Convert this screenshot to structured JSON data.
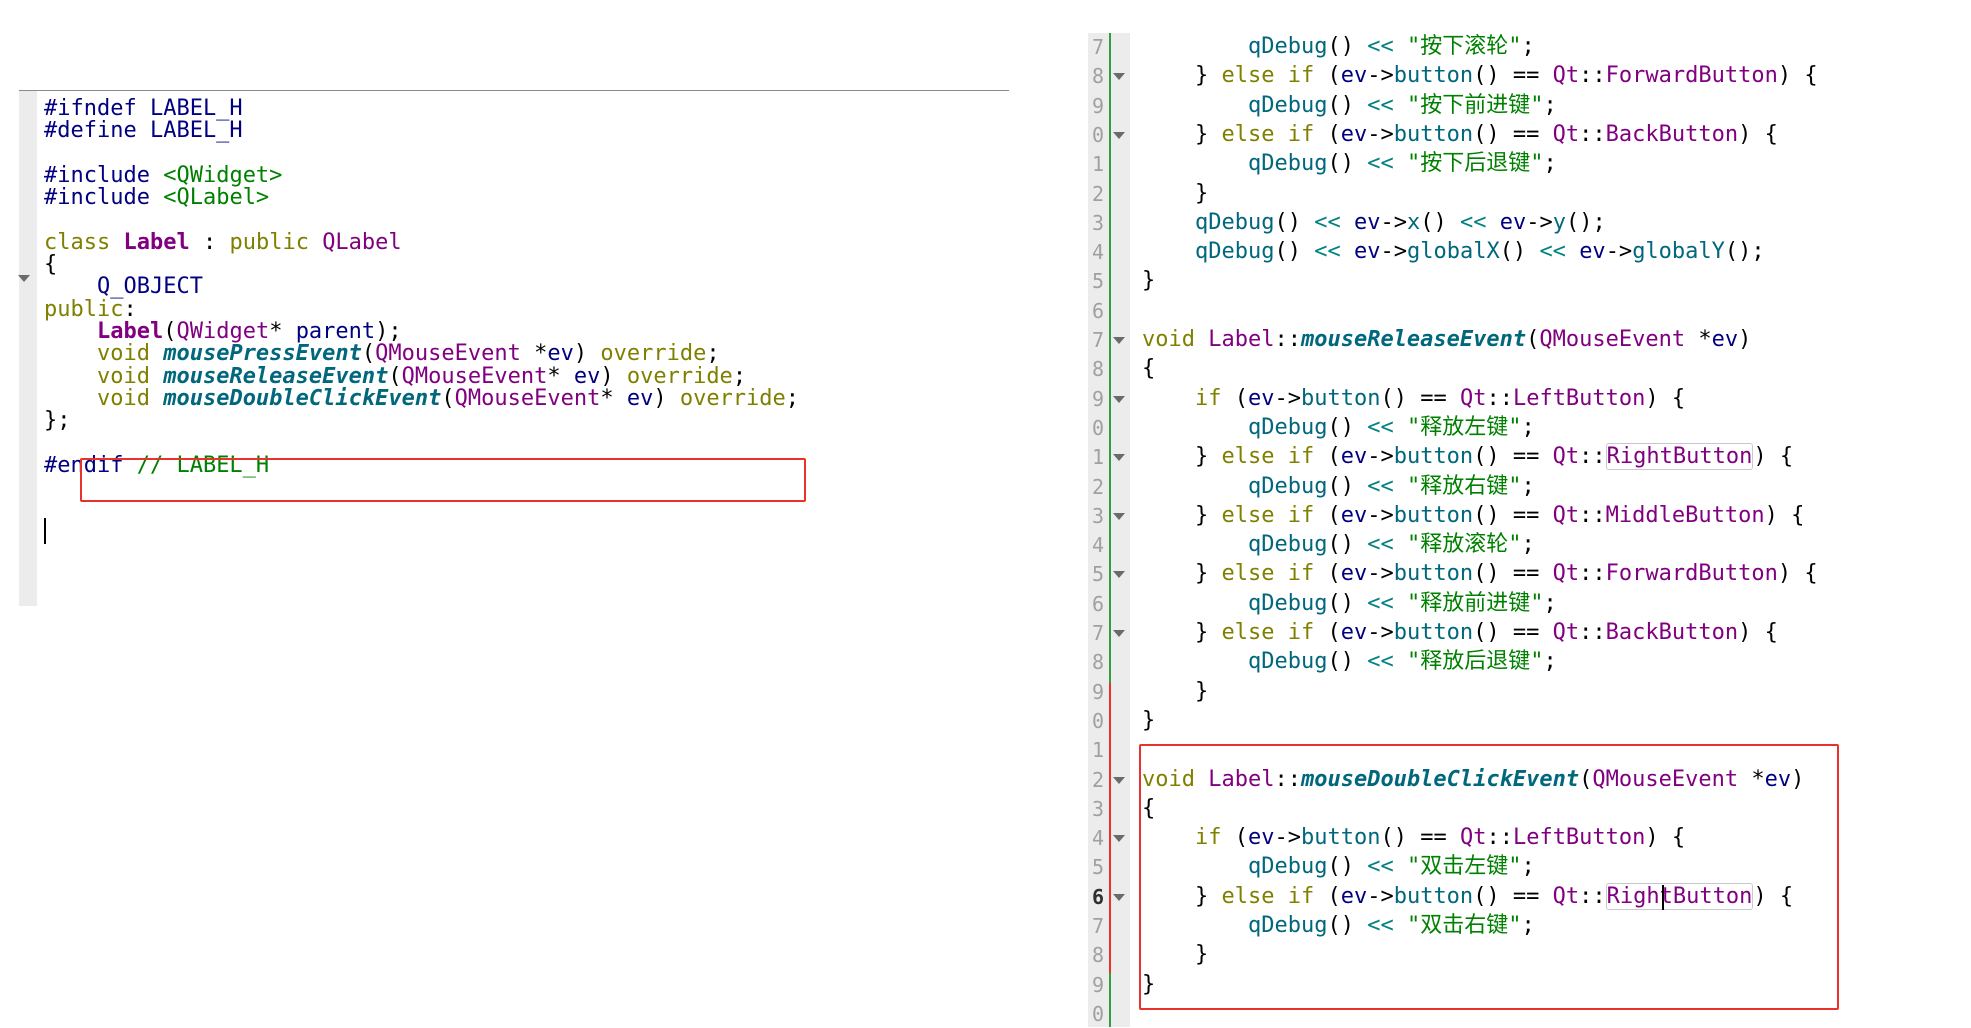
{
  "left_editor": {
    "lines": [
      [
        {
          "t": "#ifndef LABEL_H",
          "c": "pp"
        }
      ],
      [
        {
          "t": "#define LABEL_H",
          "c": "pp"
        }
      ],
      [],
      [
        {
          "t": "#include ",
          "c": "pp"
        },
        {
          "t": "<QWidget>",
          "c": "inc"
        }
      ],
      [
        {
          "t": "#include ",
          "c": "pp"
        },
        {
          "t": "<QLabel>",
          "c": "inc"
        }
      ],
      [],
      [
        {
          "t": "class ",
          "c": "kw"
        },
        {
          "t": "Label",
          "c": "cls"
        },
        {
          "t": " : ",
          "c": "plain"
        },
        {
          "t": "public ",
          "c": "kw"
        },
        {
          "t": "QLabel",
          "c": "ty"
        }
      ],
      [
        {
          "t": "{",
          "c": "plain"
        }
      ],
      [
        {
          "t": "    Q_OBJECT",
          "c": "macro"
        }
      ],
      [
        {
          "t": "public",
          "c": "kw"
        },
        {
          "t": ":",
          "c": "plain"
        }
      ],
      [
        {
          "t": "    ",
          "c": "plain"
        },
        {
          "t": "Label",
          "c": "cls"
        },
        {
          "t": "(",
          "c": "plain"
        },
        {
          "t": "QWidget",
          "c": "ty"
        },
        {
          "t": "* ",
          "c": "plain"
        },
        {
          "t": "parent",
          "c": "var"
        },
        {
          "t": ");",
          "c": "plain"
        }
      ],
      [
        {
          "t": "    ",
          "c": "plain"
        },
        {
          "t": "void ",
          "c": "kw"
        },
        {
          "t": "mousePressEvent",
          "c": "fn"
        },
        {
          "t": "(",
          "c": "plain"
        },
        {
          "t": "QMouseEvent",
          "c": "ty"
        },
        {
          "t": " *",
          "c": "plain"
        },
        {
          "t": "ev",
          "c": "var"
        },
        {
          "t": ") ",
          "c": "plain"
        },
        {
          "t": "override",
          "c": "kw"
        },
        {
          "t": ";",
          "c": "plain"
        }
      ],
      [
        {
          "t": "    ",
          "c": "plain"
        },
        {
          "t": "void ",
          "c": "kw"
        },
        {
          "t": "mouseReleaseEvent",
          "c": "fn"
        },
        {
          "t": "(",
          "c": "plain"
        },
        {
          "t": "QMouseEvent",
          "c": "ty"
        },
        {
          "t": "* ",
          "c": "plain"
        },
        {
          "t": "ev",
          "c": "var"
        },
        {
          "t": ") ",
          "c": "plain"
        },
        {
          "t": "override",
          "c": "kw"
        },
        {
          "t": ";",
          "c": "plain"
        }
      ],
      [
        {
          "t": "    ",
          "c": "plain"
        },
        {
          "t": "void ",
          "c": "kw"
        },
        {
          "t": "mouseDoubleClickEvent",
          "c": "fn"
        },
        {
          "t": "(",
          "c": "plain"
        },
        {
          "t": "QMouseEvent",
          "c": "ty"
        },
        {
          "t": "* ",
          "c": "plain"
        },
        {
          "t": "ev",
          "c": "var"
        },
        {
          "t": ") ",
          "c": "plain"
        },
        {
          "t": "override",
          "c": "kw"
        },
        {
          "t": ";",
          "c": "plain"
        }
      ],
      [
        {
          "t": "};",
          "c": "plain"
        }
      ],
      [],
      [
        {
          "t": "#endif ",
          "c": "pp"
        },
        {
          "t": "// LABEL_H",
          "c": "cm"
        }
      ]
    ]
  },
  "right_editor": {
    "line_numbers": [
      "7",
      "8",
      "9",
      "0",
      "1",
      "2",
      "3",
      "4",
      "5",
      "6",
      "7",
      "8",
      "9",
      "0",
      "1",
      "2",
      "3",
      "4",
      "5",
      "6",
      "7",
      "8",
      "9",
      "0",
      "1",
      "2",
      "3",
      "4",
      "5",
      "6",
      "7",
      "8",
      "9",
      "0"
    ],
    "lines": [
      [
        {
          "t": "        ",
          "c": "plain"
        },
        {
          "t": "qDebug",
          "c": "call"
        },
        {
          "t": "() ",
          "c": "plain"
        },
        {
          "t": "<<",
          "c": "op"
        },
        {
          "t": " \"按下滚轮\"",
          "c": "str"
        },
        {
          "t": ";",
          "c": "plain"
        }
      ],
      [
        {
          "t": "    } ",
          "c": "plain"
        },
        {
          "t": "else if ",
          "c": "kw"
        },
        {
          "t": "(",
          "c": "plain"
        },
        {
          "t": "ev",
          "c": "var"
        },
        {
          "t": "->",
          "c": "plain"
        },
        {
          "t": "button",
          "c": "call"
        },
        {
          "t": "() == ",
          "c": "plain"
        },
        {
          "t": "Qt",
          "c": "ty"
        },
        {
          "t": "::",
          "c": "plain"
        },
        {
          "t": "ForwardButton",
          "c": "ty"
        },
        {
          "t": ") {",
          "c": "plain"
        }
      ],
      [
        {
          "t": "        ",
          "c": "plain"
        },
        {
          "t": "qDebug",
          "c": "call"
        },
        {
          "t": "() ",
          "c": "plain"
        },
        {
          "t": "<<",
          "c": "op"
        },
        {
          "t": " \"按下前进键\"",
          "c": "str"
        },
        {
          "t": ";",
          "c": "plain"
        }
      ],
      [
        {
          "t": "    } ",
          "c": "plain"
        },
        {
          "t": "else if ",
          "c": "kw"
        },
        {
          "t": "(",
          "c": "plain"
        },
        {
          "t": "ev",
          "c": "var"
        },
        {
          "t": "->",
          "c": "plain"
        },
        {
          "t": "button",
          "c": "call"
        },
        {
          "t": "() == ",
          "c": "plain"
        },
        {
          "t": "Qt",
          "c": "ty"
        },
        {
          "t": "::",
          "c": "plain"
        },
        {
          "t": "BackButton",
          "c": "ty"
        },
        {
          "t": ") {",
          "c": "plain"
        }
      ],
      [
        {
          "t": "        ",
          "c": "plain"
        },
        {
          "t": "qDebug",
          "c": "call"
        },
        {
          "t": "() ",
          "c": "plain"
        },
        {
          "t": "<<",
          "c": "op"
        },
        {
          "t": " \"按下后退键\"",
          "c": "str"
        },
        {
          "t": ";",
          "c": "plain"
        }
      ],
      [
        {
          "t": "    }",
          "c": "plain"
        }
      ],
      [
        {
          "t": "    ",
          "c": "plain"
        },
        {
          "t": "qDebug",
          "c": "call"
        },
        {
          "t": "() ",
          "c": "plain"
        },
        {
          "t": "<<",
          "c": "op"
        },
        {
          "t": " ",
          "c": "plain"
        },
        {
          "t": "ev",
          "c": "var"
        },
        {
          "t": "->",
          "c": "plain"
        },
        {
          "t": "x",
          "c": "call"
        },
        {
          "t": "() ",
          "c": "plain"
        },
        {
          "t": "<<",
          "c": "op"
        },
        {
          "t": " ",
          "c": "plain"
        },
        {
          "t": "ev",
          "c": "var"
        },
        {
          "t": "->",
          "c": "plain"
        },
        {
          "t": "y",
          "c": "call"
        },
        {
          "t": "();",
          "c": "plain"
        }
      ],
      [
        {
          "t": "    ",
          "c": "plain"
        },
        {
          "t": "qDebug",
          "c": "call"
        },
        {
          "t": "() ",
          "c": "plain"
        },
        {
          "t": "<<",
          "c": "op"
        },
        {
          "t": " ",
          "c": "plain"
        },
        {
          "t": "ev",
          "c": "var"
        },
        {
          "t": "->",
          "c": "plain"
        },
        {
          "t": "globalX",
          "c": "call"
        },
        {
          "t": "() ",
          "c": "plain"
        },
        {
          "t": "<<",
          "c": "op"
        },
        {
          "t": " ",
          "c": "plain"
        },
        {
          "t": "ev",
          "c": "var"
        },
        {
          "t": "->",
          "c": "plain"
        },
        {
          "t": "globalY",
          "c": "call"
        },
        {
          "t": "();",
          "c": "plain"
        }
      ],
      [
        {
          "t": "}",
          "c": "plain"
        }
      ],
      [],
      [
        {
          "t": "void ",
          "c": "kw"
        },
        {
          "t": "Label",
          "c": "ty"
        },
        {
          "t": "::",
          "c": "plain"
        },
        {
          "t": "mouseReleaseEvent",
          "c": "fn"
        },
        {
          "t": "(",
          "c": "plain"
        },
        {
          "t": "QMouseEvent",
          "c": "ty"
        },
        {
          "t": " *",
          "c": "plain"
        },
        {
          "t": "ev",
          "c": "var"
        },
        {
          "t": ")",
          "c": "plain"
        }
      ],
      [
        {
          "t": "{",
          "c": "plain"
        }
      ],
      [
        {
          "t": "    ",
          "c": "plain"
        },
        {
          "t": "if ",
          "c": "kw"
        },
        {
          "t": "(",
          "c": "plain"
        },
        {
          "t": "ev",
          "c": "var"
        },
        {
          "t": "->",
          "c": "plain"
        },
        {
          "t": "button",
          "c": "call"
        },
        {
          "t": "() == ",
          "c": "plain"
        },
        {
          "t": "Qt",
          "c": "ty"
        },
        {
          "t": "::",
          "c": "plain"
        },
        {
          "t": "LeftButton",
          "c": "ty"
        },
        {
          "t": ") {",
          "c": "plain"
        }
      ],
      [
        {
          "t": "        ",
          "c": "plain"
        },
        {
          "t": "qDebug",
          "c": "call"
        },
        {
          "t": "() ",
          "c": "plain"
        },
        {
          "t": "<<",
          "c": "op"
        },
        {
          "t": " \"释放左键\"",
          "c": "str"
        },
        {
          "t": ";",
          "c": "plain"
        }
      ],
      [
        {
          "t": "    } ",
          "c": "plain"
        },
        {
          "t": "else if ",
          "c": "kw"
        },
        {
          "t": "(",
          "c": "plain"
        },
        {
          "t": "ev",
          "c": "var"
        },
        {
          "t": "->",
          "c": "plain"
        },
        {
          "t": "button",
          "c": "call"
        },
        {
          "t": "() == ",
          "c": "plain"
        },
        {
          "t": "Qt",
          "c": "ty"
        },
        {
          "t": "::",
          "c": "plain"
        },
        {
          "t": "RightButton",
          "c": "ty",
          "hl": true
        },
        {
          "t": ") {",
          "c": "plain"
        }
      ],
      [
        {
          "t": "        ",
          "c": "plain"
        },
        {
          "t": "qDebug",
          "c": "call"
        },
        {
          "t": "() ",
          "c": "plain"
        },
        {
          "t": "<<",
          "c": "op"
        },
        {
          "t": " \"释放右键\"",
          "c": "str"
        },
        {
          "t": ";",
          "c": "plain"
        }
      ],
      [
        {
          "t": "    } ",
          "c": "plain"
        },
        {
          "t": "else if ",
          "c": "kw"
        },
        {
          "t": "(",
          "c": "plain"
        },
        {
          "t": "ev",
          "c": "var"
        },
        {
          "t": "->",
          "c": "plain"
        },
        {
          "t": "button",
          "c": "call"
        },
        {
          "t": "() == ",
          "c": "plain"
        },
        {
          "t": "Qt",
          "c": "ty"
        },
        {
          "t": "::",
          "c": "plain"
        },
        {
          "t": "MiddleButton",
          "c": "ty"
        },
        {
          "t": ") {",
          "c": "plain"
        }
      ],
      [
        {
          "t": "        ",
          "c": "plain"
        },
        {
          "t": "qDebug",
          "c": "call"
        },
        {
          "t": "() ",
          "c": "plain"
        },
        {
          "t": "<<",
          "c": "op"
        },
        {
          "t": " \"释放滚轮\"",
          "c": "str"
        },
        {
          "t": ";",
          "c": "plain"
        }
      ],
      [
        {
          "t": "    } ",
          "c": "plain"
        },
        {
          "t": "else if ",
          "c": "kw"
        },
        {
          "t": "(",
          "c": "plain"
        },
        {
          "t": "ev",
          "c": "var"
        },
        {
          "t": "->",
          "c": "plain"
        },
        {
          "t": "button",
          "c": "call"
        },
        {
          "t": "() == ",
          "c": "plain"
        },
        {
          "t": "Qt",
          "c": "ty"
        },
        {
          "t": "::",
          "c": "plain"
        },
        {
          "t": "ForwardButton",
          "c": "ty"
        },
        {
          "t": ") {",
          "c": "plain"
        }
      ],
      [
        {
          "t": "        ",
          "c": "plain"
        },
        {
          "t": "qDebug",
          "c": "call"
        },
        {
          "t": "() ",
          "c": "plain"
        },
        {
          "t": "<<",
          "c": "op"
        },
        {
          "t": " \"释放前进键\"",
          "c": "str"
        },
        {
          "t": ";",
          "c": "plain"
        }
      ],
      [
        {
          "t": "    } ",
          "c": "plain"
        },
        {
          "t": "else if ",
          "c": "kw"
        },
        {
          "t": "(",
          "c": "plain"
        },
        {
          "t": "ev",
          "c": "var"
        },
        {
          "t": "->",
          "c": "plain"
        },
        {
          "t": "button",
          "c": "call"
        },
        {
          "t": "() == ",
          "c": "plain"
        },
        {
          "t": "Qt",
          "c": "ty"
        },
        {
          "t": "::",
          "c": "plain"
        },
        {
          "t": "BackButton",
          "c": "ty"
        },
        {
          "t": ") {",
          "c": "plain"
        }
      ],
      [
        {
          "t": "        ",
          "c": "plain"
        },
        {
          "t": "qDebug",
          "c": "call"
        },
        {
          "t": "() ",
          "c": "plain"
        },
        {
          "t": "<<",
          "c": "op"
        },
        {
          "t": " \"释放后退键\"",
          "c": "str"
        },
        {
          "t": ";",
          "c": "plain"
        }
      ],
      [
        {
          "t": "    }",
          "c": "plain"
        }
      ],
      [
        {
          "t": "}",
          "c": "plain"
        }
      ],
      [],
      [
        {
          "t": "void ",
          "c": "kw"
        },
        {
          "t": "Label",
          "c": "ty"
        },
        {
          "t": "::",
          "c": "plain"
        },
        {
          "t": "mouseDoubleClickEvent",
          "c": "fn"
        },
        {
          "t": "(",
          "c": "plain"
        },
        {
          "t": "QMouseEvent",
          "c": "ty"
        },
        {
          "t": " *",
          "c": "plain"
        },
        {
          "t": "ev",
          "c": "var"
        },
        {
          "t": ")",
          "c": "plain"
        }
      ],
      [
        {
          "t": "{",
          "c": "plain"
        }
      ],
      [
        {
          "t": "    ",
          "c": "plain"
        },
        {
          "t": "if ",
          "c": "kw"
        },
        {
          "t": "(",
          "c": "plain"
        },
        {
          "t": "ev",
          "c": "var"
        },
        {
          "t": "->",
          "c": "plain"
        },
        {
          "t": "button",
          "c": "call"
        },
        {
          "t": "() == ",
          "c": "plain"
        },
        {
          "t": "Qt",
          "c": "ty"
        },
        {
          "t": "::",
          "c": "plain"
        },
        {
          "t": "LeftButton",
          "c": "ty"
        },
        {
          "t": ") {",
          "c": "plain"
        }
      ],
      [
        {
          "t": "        ",
          "c": "plain"
        },
        {
          "t": "qDebug",
          "c": "call"
        },
        {
          "t": "() ",
          "c": "plain"
        },
        {
          "t": "<<",
          "c": "op"
        },
        {
          "t": " \"双击左键\"",
          "c": "str"
        },
        {
          "t": ";",
          "c": "plain"
        }
      ],
      [
        {
          "t": "    } ",
          "c": "plain"
        },
        {
          "t": "else if ",
          "c": "kw"
        },
        {
          "t": "(",
          "c": "plain"
        },
        {
          "t": "ev",
          "c": "var"
        },
        {
          "t": "->",
          "c": "plain"
        },
        {
          "t": "button",
          "c": "call"
        },
        {
          "t": "() == ",
          "c": "plain"
        },
        {
          "t": "Qt",
          "c": "ty"
        },
        {
          "t": "::",
          "c": "plain"
        },
        {
          "t": "RightButton",
          "c": "ty",
          "hl": true
        },
        {
          "t": ") {",
          "c": "plain"
        }
      ],
      [
        {
          "t": "        ",
          "c": "plain"
        },
        {
          "t": "qDebug",
          "c": "call"
        },
        {
          "t": "() ",
          "c": "plain"
        },
        {
          "t": "<<",
          "c": "op"
        },
        {
          "t": " \"双击右键\"",
          "c": "str"
        },
        {
          "t": ";",
          "c": "plain"
        }
      ],
      [
        {
          "t": "    }",
          "c": "plain"
        }
      ],
      [
        {
          "t": "}",
          "c": "plain"
        }
      ],
      []
    ]
  },
  "colors": {
    "highlight_box": "#e8322b",
    "gutter": "#ececec",
    "change_marker_green": "#2e9e3e",
    "change_marker_red": "#e8322b"
  },
  "icons": [
    "fold-arrow-icon"
  ]
}
